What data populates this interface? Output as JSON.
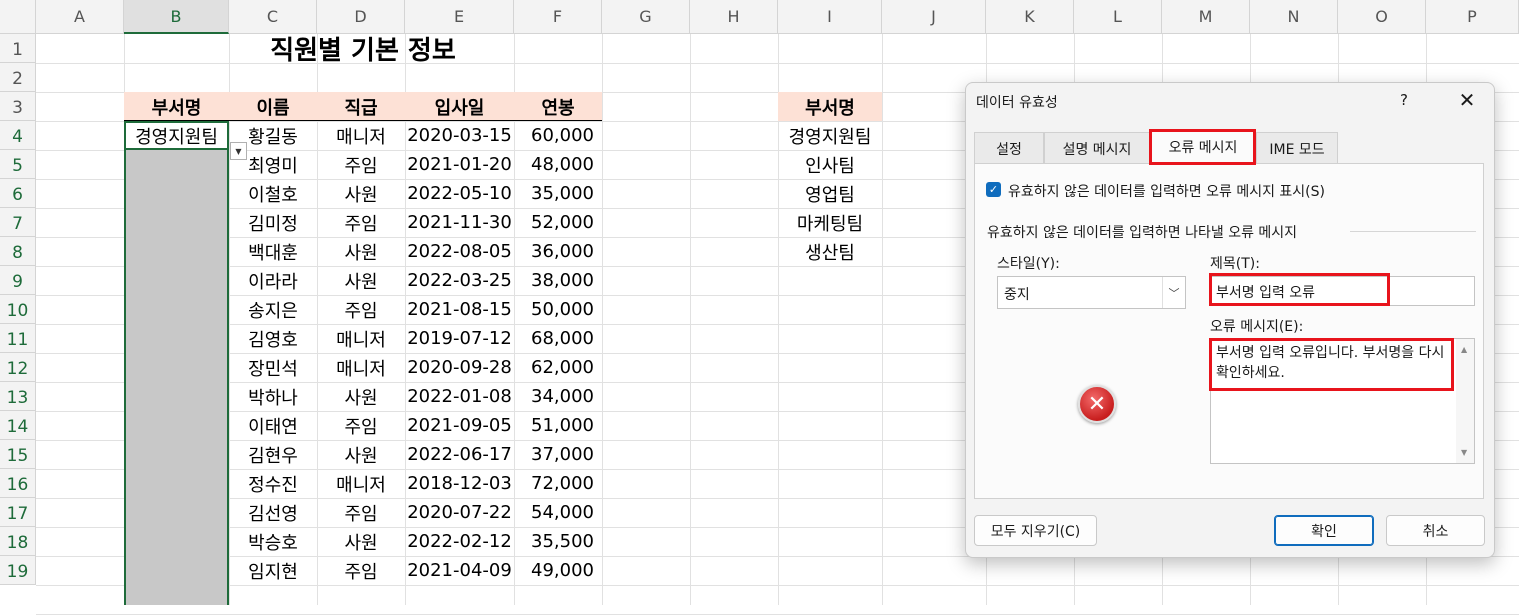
{
  "columns": [
    "A",
    "B",
    "C",
    "D",
    "E",
    "F",
    "G",
    "H",
    "I",
    "J",
    "K",
    "L",
    "M",
    "N",
    "O",
    "P"
  ],
  "rows": [
    "1",
    "2",
    "3",
    "4",
    "5",
    "6",
    "7",
    "8",
    "9",
    "10",
    "11",
    "12",
    "13",
    "14",
    "15",
    "16",
    "17",
    "18",
    "19"
  ],
  "sheet_title": "직원별 기본 정보",
  "table_headers": [
    "부서명",
    "이름",
    "직급",
    "입사일",
    "연봉"
  ],
  "active_cell_value": "경영지원팀",
  "employees": [
    {
      "name": "황길동",
      "rank": "매니저",
      "date": "2020-03-15",
      "salary": "60,000"
    },
    {
      "name": "최영미",
      "rank": "주임",
      "date": "2021-01-20",
      "salary": "48,000"
    },
    {
      "name": "이철호",
      "rank": "사원",
      "date": "2022-05-10",
      "salary": "35,000"
    },
    {
      "name": "김미정",
      "rank": "주임",
      "date": "2021-11-30",
      "salary": "52,000"
    },
    {
      "name": "백대훈",
      "rank": "사원",
      "date": "2022-08-05",
      "salary": "36,000"
    },
    {
      "name": "이라라",
      "rank": "사원",
      "date": "2022-03-25",
      "salary": "38,000"
    },
    {
      "name": "송지은",
      "rank": "주임",
      "date": "2021-08-15",
      "salary": "50,000"
    },
    {
      "name": "김영호",
      "rank": "매니저",
      "date": "2019-07-12",
      "salary": "68,000"
    },
    {
      "name": "장민석",
      "rank": "매니저",
      "date": "2020-09-28",
      "salary": "62,000"
    },
    {
      "name": "박하나",
      "rank": "사원",
      "date": "2022-01-08",
      "salary": "34,000"
    },
    {
      "name": "이태연",
      "rank": "주임",
      "date": "2021-09-05",
      "salary": "51,000"
    },
    {
      "name": "김현우",
      "rank": "사원",
      "date": "2022-06-17",
      "salary": "37,000"
    },
    {
      "name": "정수진",
      "rank": "매니저",
      "date": "2018-12-03",
      "salary": "72,000"
    },
    {
      "name": "김선영",
      "rank": "주임",
      "date": "2020-07-22",
      "salary": "54,000"
    },
    {
      "name": "박승호",
      "rank": "사원",
      "date": "2022-02-12",
      "salary": "35,500"
    },
    {
      "name": "임지현",
      "rank": "주임",
      "date": "2021-04-09",
      "salary": "49,000"
    }
  ],
  "dept_list": {
    "header": "부서명",
    "items": [
      "경영지원팀",
      "인사팀",
      "영업팀",
      "마케팅팀",
      "생산팀"
    ]
  },
  "dialog": {
    "title": "데이터 유효성",
    "help": "?",
    "close": "✕",
    "tabs": [
      "설정",
      "설명 메시지",
      "오류 메시지",
      "IME 모드"
    ],
    "active_tab": "오류 메시지",
    "show_error_checkbox": "유효하지 않은 데이터를 입력하면 오류 메시지 표시(S)",
    "show_error_checked": true,
    "section_label": "유효하지 않은 데이터를 입력하면 나타낼 오류 메시지",
    "style_label": "스타일(Y):",
    "style_value": "중지",
    "title_label": "제목(T):",
    "title_value": "부서명 입력 오류",
    "message_label": "오류 메시지(E):",
    "message_value": "부서명 입력 오류입니다. 부서명을 다시 확인하세요.",
    "clear_all_button": "모두 지우기(C)",
    "ok_button": "확인",
    "cancel_button": "취소"
  },
  "colors": {
    "header_fill": "#fde1d6",
    "selection_border": "#1e6b3a",
    "highlight_red": "#e8141c",
    "accent_blue": "#0f6cbd"
  }
}
